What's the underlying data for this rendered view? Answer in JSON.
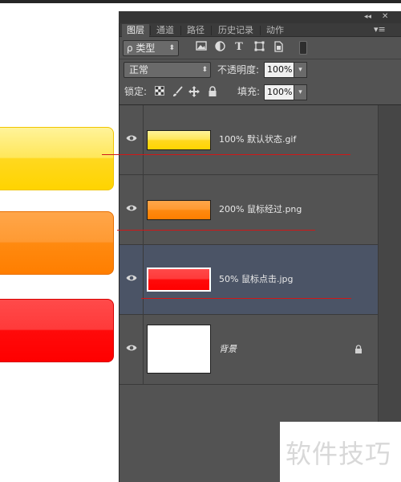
{
  "panel": {
    "tabs": [
      {
        "label": "图层",
        "active": true
      },
      {
        "label": "通道",
        "active": false
      },
      {
        "label": "路径",
        "active": false
      },
      {
        "label": "历史记录",
        "active": false
      },
      {
        "label": "动作",
        "active": false
      }
    ],
    "collapse_glyph": "◂◂",
    "close_glyph": "✕",
    "menu_glyph": "▾≡"
  },
  "filter": {
    "label": "ρ 类型",
    "caret": "⬍",
    "icons": [
      "image-filter-icon",
      "adjustment-filter-icon",
      "type-filter-icon",
      "shape-filter-icon",
      "smart-object-filter-icon"
    ]
  },
  "blend": {
    "mode": "正常",
    "caret": "⬍",
    "opacity_label": "不透明度:",
    "opacity_value": "100%",
    "fill_label": "填充:",
    "fill_value": "100%",
    "dropdown_glyph": "▾"
  },
  "lock": {
    "label": "锁定:",
    "icons": [
      "lock-transparent-icon",
      "lock-paint-icon",
      "lock-move-icon",
      "lock-all-icon"
    ]
  },
  "layers": [
    {
      "name": "100% 默认状态.gif",
      "thumb": "yellow-button",
      "selected": false
    },
    {
      "name": "200% 鼠标经过.png",
      "thumb": "orange-button",
      "selected": false
    },
    {
      "name": "50% 鼠标点击.jpg",
      "thumb": "red-button",
      "selected": true
    },
    {
      "name": "背景",
      "thumb": "white",
      "selected": false,
      "locked": true
    }
  ],
  "icons": {
    "eye": "visibility-eye-icon",
    "lock": "lock-icon"
  },
  "colors": {
    "panel_bg": "#535353",
    "selected_layer": "#4b5466",
    "guide_line": "#d01818",
    "button_yellow": "#ffd400",
    "button_orange": "#ff7e00",
    "button_red": "#ff0000"
  },
  "watermark": "软件技巧"
}
